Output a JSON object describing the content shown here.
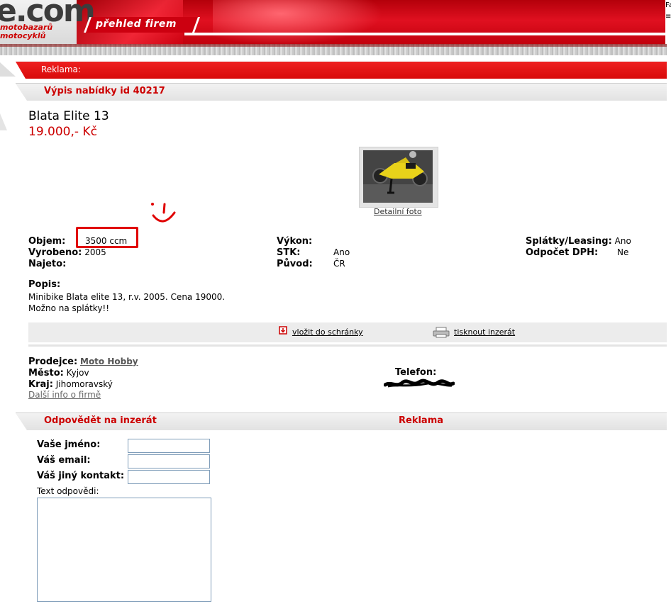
{
  "header": {
    "logo_text": "e.com",
    "logo_sub_1": "motobazarů",
    "logo_sub_2": "motocyklů",
    "nav_tab_label": "přehled firem",
    "edge_text_1": "Fa",
    "edge_text_2": "≡"
  },
  "reklama": {
    "label": "Reklama:"
  },
  "offer_section": {
    "title": "Výpis nabídky id 40217"
  },
  "listing": {
    "title": "Blata Elite 13",
    "price": "19.000,- Kč",
    "photo_link": "Detailní foto"
  },
  "specs": {
    "objem_label": "Objem:",
    "objem_value": "3500 ccm",
    "vyrobeno_label": "Vyrobeno:",
    "vyrobeno_value": "2005",
    "najeto_label": "Najeto:",
    "najeto_value": "",
    "vykon_label": "Výkon:",
    "vykon_value": "",
    "stk_label": "STK:",
    "stk_value": "Ano",
    "puvod_label": "Původ:",
    "puvod_value": "ČR",
    "splatky_label": "Splátky/Leasing:",
    "splatky_value": "Ano",
    "odpocet_label": "Odpočet DPH:",
    "odpocet_value": "Ne"
  },
  "popis": {
    "label": "Popis:",
    "line1": "Minibike Blata elite 13, r.v. 2005. Cena 19000.",
    "line2": "Možno na splátky!!"
  },
  "actions": {
    "save_label": "vložit do schránky",
    "print_label": "tisknout inzerát"
  },
  "seller": {
    "prodejce_label": "Prodejce:",
    "prodejce_value": "Moto Hobby",
    "mesto_label": "Město:",
    "mesto_value": "Kyjov",
    "kraj_label": "Kraj:",
    "kraj_value": "Jihomoravský",
    "more_link": "Další info o firmě",
    "telefon_label": "Telefon:"
  },
  "reply_section": {
    "title": "Odpovědět na inzerát",
    "ad_title": "Reklama",
    "name_label": "Vaše jméno:",
    "email_label": "Váš email:",
    "contact_label": "Váš jiný kontakt:",
    "text_label": "Text odpovědi:",
    "name_value": "",
    "email_value": "",
    "contact_value": "",
    "text_value": ""
  },
  "colors": {
    "accent_red": "#cc0000",
    "header_red": "#e01020",
    "bar_gray": "#e6e6e6",
    "annotation_red": "#e00000"
  }
}
